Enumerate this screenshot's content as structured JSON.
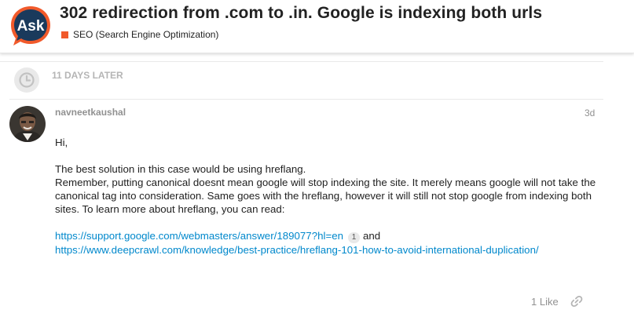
{
  "header": {
    "logo_text": "Ask",
    "topic_title": "302 redirection from .com to .in. Google is indexing both urls",
    "category": "SEO (Search Engine Optimization)",
    "category_color": "#f1592a",
    "logo_color": "#1a3a5c",
    "logo_accent": "#f15a2b"
  },
  "time_gap": {
    "label": "11 DAYS LATER",
    "icon": "clock-icon"
  },
  "post": {
    "username": "navneetkaushal",
    "date": "3d",
    "greeting": "Hi,",
    "paragraph_lines": [
      "The best solution in this case would be using hreflang.",
      "Remember, putting canonical doesnt mean google will stop indexing the site. It merely means google will not take the canonical tag into consideration. Same goes with the hreflang, however it will still not stop google from indexing both sites. To learn more about hreflang, you can read:"
    ],
    "link1": "https://support.google.com/webmasters/answer/189077?hl=en",
    "link1_clicks": "1",
    "and_text": "and",
    "link2": "https://www.deepcrawl.com/knowledge/best-practice/hreflang-101-how-to-avoid-international-duplication/",
    "link_color": "#0088cc"
  },
  "actions": {
    "like_label": "1 Like",
    "share_icon": "link-icon"
  }
}
